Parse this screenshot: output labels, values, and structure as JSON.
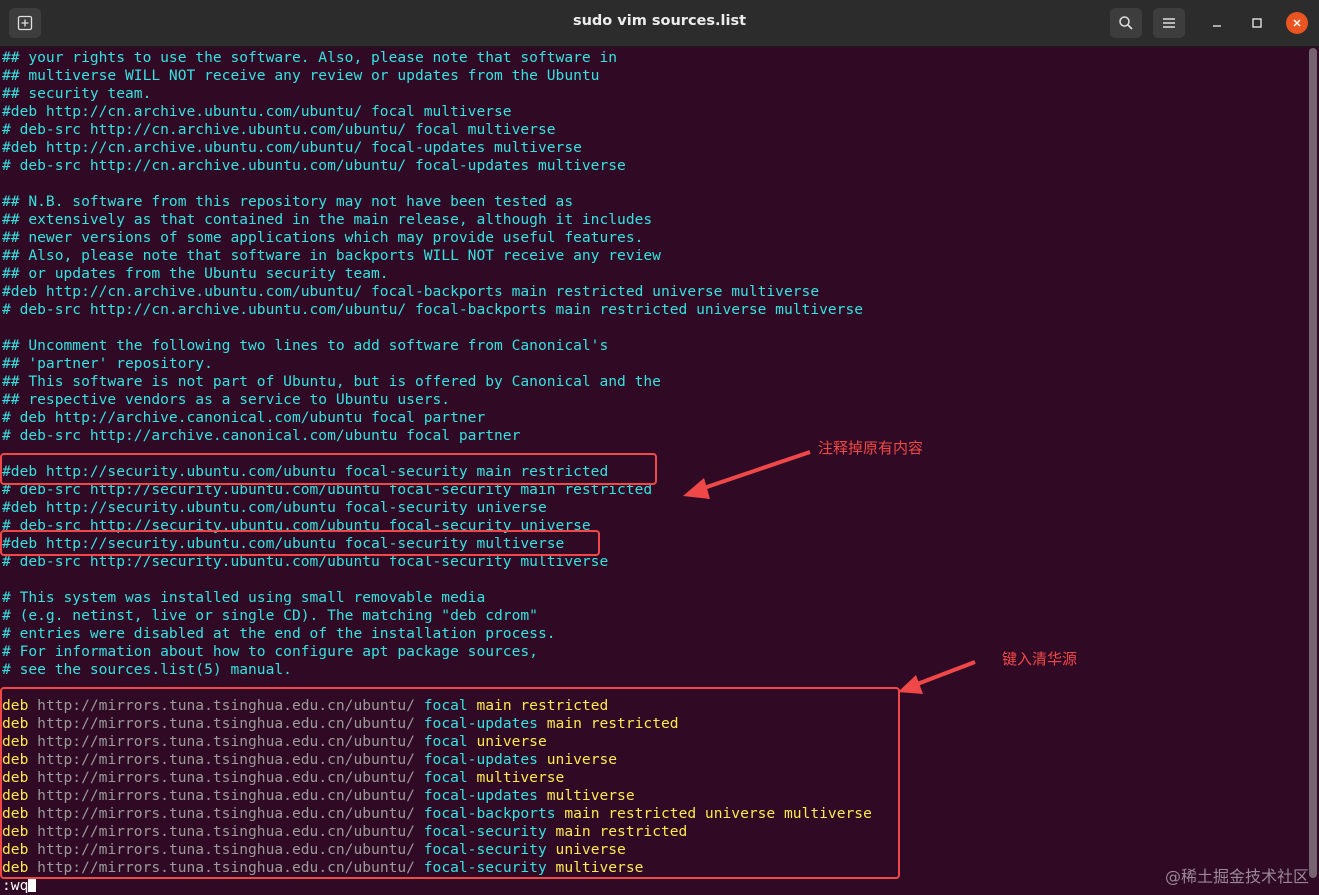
{
  "window": {
    "title": "sudo vim sources.list"
  },
  "icons": {
    "new_tab": "new-tab-icon",
    "search": "search-icon",
    "menu": "hamburger-menu-icon",
    "minimize": "minimize-icon",
    "maximize": "maximize-icon",
    "close": "close-icon"
  },
  "lines": [
    {
      "parts": [
        {
          "t": "## your rights to use the software. Also, please note that software in",
          "c": "c"
        }
      ]
    },
    {
      "parts": [
        {
          "t": "## multiverse WILL NOT receive any review or updates from the Ubuntu",
          "c": "c"
        }
      ]
    },
    {
      "parts": [
        {
          "t": "## security team.",
          "c": "c"
        }
      ]
    },
    {
      "parts": [
        {
          "t": "#deb http://cn.archive.ubuntu.com/ubuntu/ focal multiverse",
          "c": "c"
        }
      ]
    },
    {
      "parts": [
        {
          "t": "# deb-src http://cn.archive.ubuntu.com/ubuntu/ focal multiverse",
          "c": "c"
        }
      ]
    },
    {
      "parts": [
        {
          "t": "#deb http://cn.archive.ubuntu.com/ubuntu/ focal-updates multiverse",
          "c": "c"
        }
      ]
    },
    {
      "parts": [
        {
          "t": "# deb-src http://cn.archive.ubuntu.com/ubuntu/ focal-updates multiverse",
          "c": "c"
        }
      ]
    },
    {
      "parts": [
        {
          "t": "",
          "c": "c"
        }
      ]
    },
    {
      "parts": [
        {
          "t": "## N.B. software from this repository may not have been tested as",
          "c": "c"
        }
      ]
    },
    {
      "parts": [
        {
          "t": "## extensively as that contained in the main release, although it includes",
          "c": "c"
        }
      ]
    },
    {
      "parts": [
        {
          "t": "## newer versions of some applications which may provide useful features.",
          "c": "c"
        }
      ]
    },
    {
      "parts": [
        {
          "t": "## Also, please note that software in backports WILL NOT receive any review",
          "c": "c"
        }
      ]
    },
    {
      "parts": [
        {
          "t": "## or updates from the Ubuntu security team.",
          "c": "c"
        }
      ]
    },
    {
      "parts": [
        {
          "t": "#deb http://cn.archive.ubuntu.com/ubuntu/ focal-backports main restricted universe multiverse",
          "c": "c"
        }
      ]
    },
    {
      "parts": [
        {
          "t": "# deb-src http://cn.archive.ubuntu.com/ubuntu/ focal-backports main restricted universe multiverse",
          "c": "c"
        }
      ]
    },
    {
      "parts": [
        {
          "t": "",
          "c": "c"
        }
      ]
    },
    {
      "parts": [
        {
          "t": "## Uncomment the following two lines to add software from Canonical's",
          "c": "c"
        }
      ]
    },
    {
      "parts": [
        {
          "t": "## 'partner' repository.",
          "c": "c"
        }
      ]
    },
    {
      "parts": [
        {
          "t": "## This software is not part of Ubuntu, but is offered by Canonical and the",
          "c": "c"
        }
      ]
    },
    {
      "parts": [
        {
          "t": "## respective vendors as a service to Ubuntu users.",
          "c": "c"
        }
      ]
    },
    {
      "parts": [
        {
          "t": "# deb http://archive.canonical.com/ubuntu focal partner",
          "c": "c"
        }
      ]
    },
    {
      "parts": [
        {
          "t": "# deb-src http://archive.canonical.com/ubuntu focal partner",
          "c": "c"
        }
      ]
    },
    {
      "parts": [
        {
          "t": "",
          "c": "c"
        }
      ]
    },
    {
      "parts": [
        {
          "t": "#deb http://security.ubuntu.com/ubuntu focal-security main restricted",
          "c": "c"
        }
      ]
    },
    {
      "parts": [
        {
          "t": "# deb-src http://security.ubuntu.com/ubuntu focal-security main restricted",
          "c": "c"
        }
      ]
    },
    {
      "parts": [
        {
          "t": "#deb http://security.ubuntu.com/ubuntu focal-security universe",
          "c": "c"
        }
      ]
    },
    {
      "parts": [
        {
          "t": "# deb-src http://security.ubuntu.com/ubuntu focal-security universe",
          "c": "c"
        }
      ]
    },
    {
      "parts": [
        {
          "t": "#deb http://security.ubuntu.com/ubuntu focal-security multiverse",
          "c": "c"
        }
      ]
    },
    {
      "parts": [
        {
          "t": "# deb-src http://security.ubuntu.com/ubuntu focal-security multiverse",
          "c": "c"
        }
      ]
    },
    {
      "parts": [
        {
          "t": "",
          "c": "c"
        }
      ]
    },
    {
      "parts": [
        {
          "t": "# This system was installed using small removable media",
          "c": "c"
        }
      ]
    },
    {
      "parts": [
        {
          "t": "# (e.g. netinst, live or single CD). The matching \"deb cdrom\"",
          "c": "c"
        }
      ]
    },
    {
      "parts": [
        {
          "t": "# entries were disabled at the end of the installation process.",
          "c": "c"
        }
      ]
    },
    {
      "parts": [
        {
          "t": "# For information about how to configure apt package sources,",
          "c": "c"
        }
      ]
    },
    {
      "parts": [
        {
          "t": "# see the sources.list(5) manual.",
          "c": "c"
        }
      ]
    },
    {
      "parts": [
        {
          "t": "",
          "c": "c"
        }
      ]
    },
    {
      "parts": [
        {
          "t": "deb ",
          "c": "y"
        },
        {
          "t": "http://mirrors.tuna.tsinghua.edu.cn/ubuntu/ ",
          "c": "g"
        },
        {
          "t": "focal ",
          "c": "c"
        },
        {
          "t": "main restricted",
          "c": "y"
        }
      ]
    },
    {
      "parts": [
        {
          "t": "deb ",
          "c": "y"
        },
        {
          "t": "http://mirrors.tuna.tsinghua.edu.cn/ubuntu/ ",
          "c": "g"
        },
        {
          "t": "focal-updates ",
          "c": "c"
        },
        {
          "t": "main restricted",
          "c": "y"
        }
      ]
    },
    {
      "parts": [
        {
          "t": "deb ",
          "c": "y"
        },
        {
          "t": "http://mirrors.tuna.tsinghua.edu.cn/ubuntu/ ",
          "c": "g"
        },
        {
          "t": "focal ",
          "c": "c"
        },
        {
          "t": "universe",
          "c": "y"
        }
      ]
    },
    {
      "parts": [
        {
          "t": "deb ",
          "c": "y"
        },
        {
          "t": "http://mirrors.tuna.tsinghua.edu.cn/ubuntu/ ",
          "c": "g"
        },
        {
          "t": "focal-updates ",
          "c": "c"
        },
        {
          "t": "universe",
          "c": "y"
        }
      ]
    },
    {
      "parts": [
        {
          "t": "deb ",
          "c": "y"
        },
        {
          "t": "http://mirrors.tuna.tsinghua.edu.cn/ubuntu/ ",
          "c": "g"
        },
        {
          "t": "focal ",
          "c": "c"
        },
        {
          "t": "multiverse",
          "c": "y"
        }
      ]
    },
    {
      "parts": [
        {
          "t": "deb ",
          "c": "y"
        },
        {
          "t": "http://mirrors.tuna.tsinghua.edu.cn/ubuntu/ ",
          "c": "g"
        },
        {
          "t": "focal-updates ",
          "c": "c"
        },
        {
          "t": "multiverse",
          "c": "y"
        }
      ]
    },
    {
      "parts": [
        {
          "t": "deb ",
          "c": "y"
        },
        {
          "t": "http://mirrors.tuna.tsinghua.edu.cn/ubuntu/ ",
          "c": "g"
        },
        {
          "t": "focal-backports ",
          "c": "c"
        },
        {
          "t": "main restricted universe multiverse",
          "c": "y"
        }
      ]
    },
    {
      "parts": [
        {
          "t": "deb ",
          "c": "y"
        },
        {
          "t": "http://mirrors.tuna.tsinghua.edu.cn/ubuntu/ ",
          "c": "g"
        },
        {
          "t": "focal-security ",
          "c": "c"
        },
        {
          "t": "main restricted",
          "c": "y"
        }
      ]
    },
    {
      "parts": [
        {
          "t": "deb ",
          "c": "y"
        },
        {
          "t": "http://mirrors.tuna.tsinghua.edu.cn/ubuntu/ ",
          "c": "g"
        },
        {
          "t": "focal-security ",
          "c": "c"
        },
        {
          "t": "universe",
          "c": "y"
        }
      ]
    },
    {
      "parts": [
        {
          "t": "deb ",
          "c": "y"
        },
        {
          "t": "http://mirrors.tuna.tsinghua.edu.cn/ubuntu/ ",
          "c": "g"
        },
        {
          "t": "focal-security ",
          "c": "c"
        },
        {
          "t": "multiverse",
          "c": "y"
        }
      ]
    }
  ],
  "command_line": ":wq",
  "annotations": {
    "comment_out": "注释掉原有内容",
    "add_tsinghua": "键入清华源"
  },
  "watermark": "@稀土掘金技术社区",
  "colors": {
    "background": "#300a24",
    "comment": "#34e2e2",
    "keyword": "#fce94f",
    "url": "#9a9a9a",
    "annotation": "#f04848"
  }
}
